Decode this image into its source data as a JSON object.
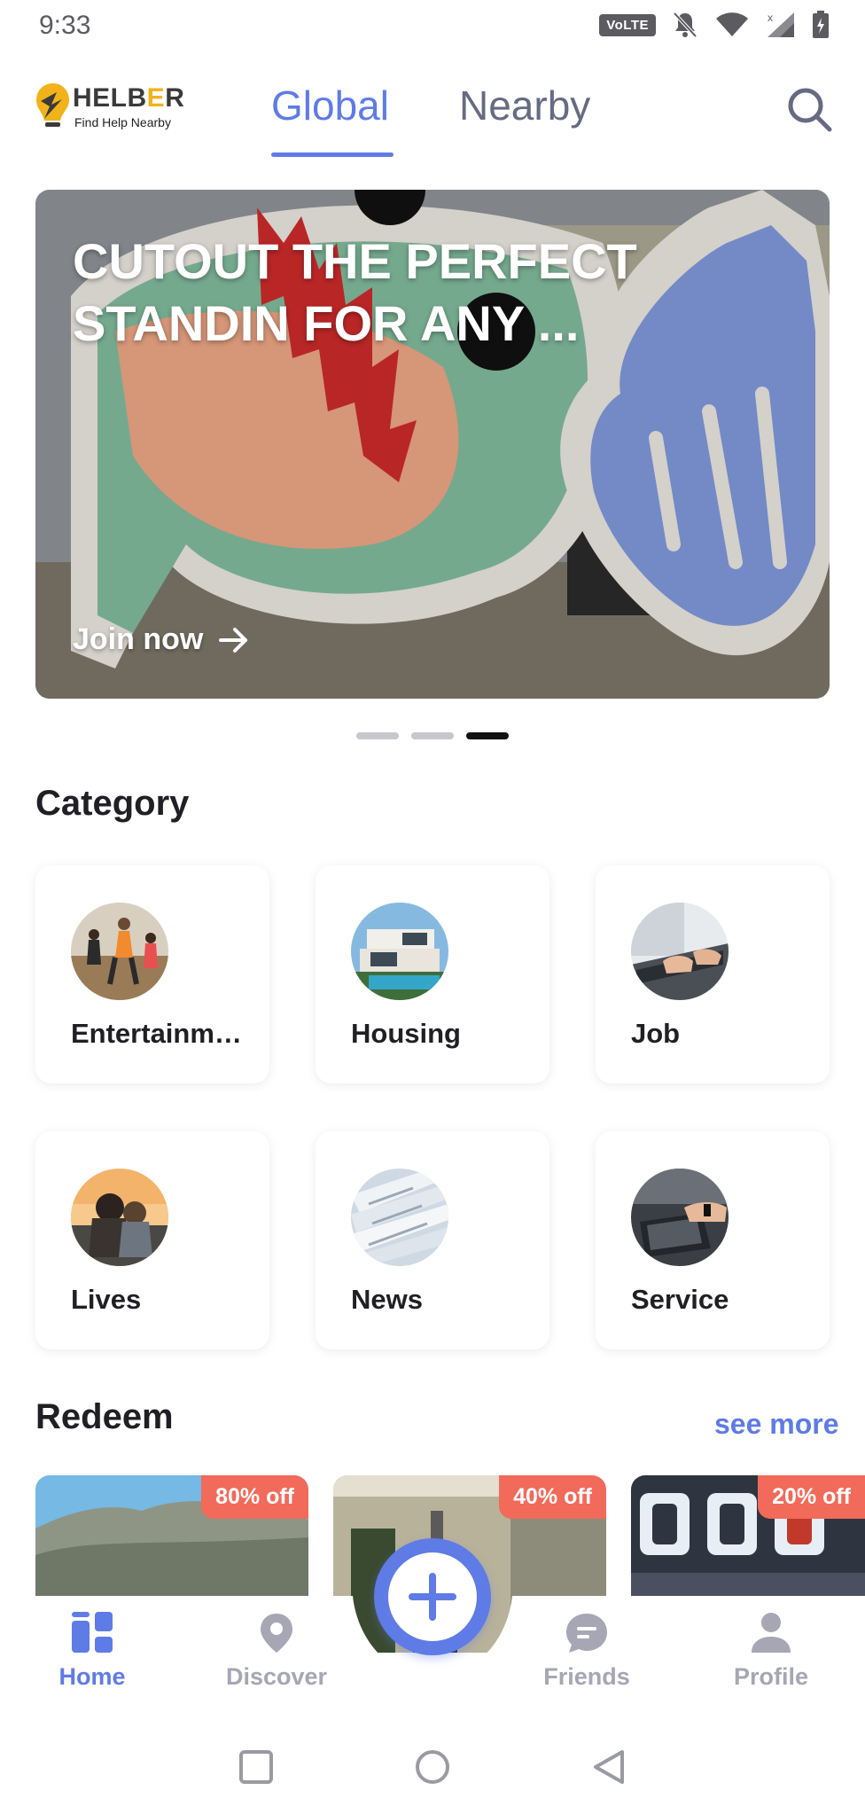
{
  "status_bar": {
    "time": "9:33",
    "network_badge": "VoLTE",
    "icons": [
      "volte-icon",
      "bell-off-icon",
      "wifi-icon",
      "signal-icon",
      "battery-icon"
    ]
  },
  "header": {
    "logo_name_1": "HELB",
    "logo_name_o": "E",
    "logo_name_2": "R",
    "logo_tagline": "Find Help Nearby",
    "tabs": [
      {
        "label": "Global",
        "active": true
      },
      {
        "label": "Nearby",
        "active": false
      }
    ],
    "search_icon": "search-icon"
  },
  "banner": {
    "title": "CUTOUT THE PERFECT STANDIN FOR ANY ...",
    "cta_label": "Join now",
    "cta_icon": "arrow-right-icon",
    "pages": 3,
    "active_page": 3
  },
  "category": {
    "title": "Category",
    "items": [
      {
        "label": "Entertainment"
      },
      {
        "label": "Housing"
      },
      {
        "label": "Job"
      },
      {
        "label": "Lives"
      },
      {
        "label": "News"
      },
      {
        "label": "Service"
      }
    ]
  },
  "redeem": {
    "title": "Redeem",
    "see_more": "see more",
    "items": [
      {
        "badge": "80% off"
      },
      {
        "badge": "40% off"
      },
      {
        "badge": "20% off"
      }
    ]
  },
  "bottom_nav": {
    "items": [
      {
        "label": "Home",
        "icon": "dashboard-icon",
        "active": true
      },
      {
        "label": "Discover",
        "icon": "map-pin-icon",
        "active": false
      },
      {
        "label": "Friends",
        "icon": "chat-bubble-icon",
        "active": false
      },
      {
        "label": "Profile",
        "icon": "person-icon",
        "active": false
      }
    ],
    "fab_icon": "plus-icon"
  },
  "colors": {
    "accent": "#5f7be6",
    "badge": "#f26a5a",
    "inactive": "#a6a6b4"
  }
}
